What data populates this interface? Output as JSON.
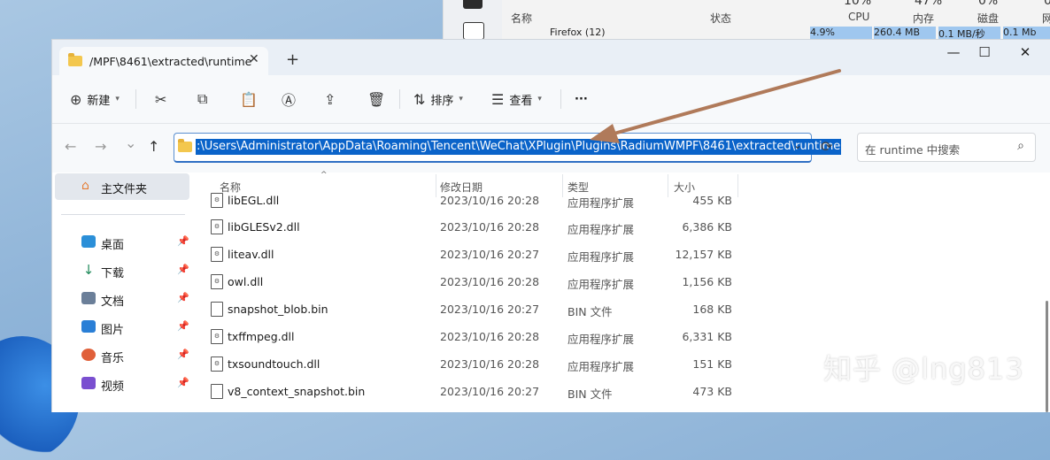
{
  "colors": {
    "accent": "#0a63c9",
    "arrow": "#b07a5a",
    "folder": "#f3c74e"
  },
  "taskmgr": {
    "col_name": "名称",
    "col_status": "状态",
    "cpu_pct": "10%",
    "cpu_label": "CPU",
    "mem_pct": "47%",
    "mem_label": "内存",
    "disk_pct": "0%",
    "disk_label": "磁盘",
    "net_pct": "0",
    "net_label": "网",
    "row_name": "Firefox (12)",
    "row_cpu": "4.9%",
    "row_mem": "260.4 MB",
    "row_disk": "0.1 MB/秒",
    "row_net": "0.1 Mb"
  },
  "explorer": {
    "tab_title": "/MPF\\8461\\extracted\\runtime",
    "tab_close": "✕",
    "new_tab": "+",
    "window_controls": {
      "minimize": "—",
      "maximize": "☐",
      "close": "✕"
    },
    "toolbar": {
      "new_label": "新建",
      "sort_label": "排序",
      "view_label": "查看",
      "more": "···"
    },
    "nav": {
      "back": "←",
      "forward": "→",
      "recent": "⌄",
      "up": "↑"
    },
    "address_path": ":\\Users\\Administrator\\AppData\\Roaming\\Tencent\\WeChat\\XPlugin\\Plugins\\RadiumWMPF\\8461\\extracted\\runtime",
    "search_placeholder": "在 runtime 中搜索",
    "sidebar": {
      "home": "主文件夹",
      "items": [
        {
          "label": "桌面",
          "icon": "desktop-icon",
          "color": "#2b8fd8"
        },
        {
          "label": "下载",
          "icon": "download-icon",
          "color": "#1f8a5a"
        },
        {
          "label": "文档",
          "icon": "documents-icon",
          "color": "#6b7f99"
        },
        {
          "label": "图片",
          "icon": "pictures-icon",
          "color": "#2a7fd6"
        },
        {
          "label": "音乐",
          "icon": "music-icon",
          "color": "#e0603a"
        },
        {
          "label": "视频",
          "icon": "videos-icon",
          "color": "#7a4fd0"
        }
      ]
    },
    "columns": {
      "name": "名称",
      "date": "修改日期",
      "type": "类型",
      "size": "大小"
    },
    "files": [
      {
        "name": "libEGL.dll",
        "date": "2023/10/16 20:28",
        "type": "应用程序扩展",
        "size": "455 KB",
        "kind": "dll"
      },
      {
        "name": "libGLESv2.dll",
        "date": "2023/10/16 20:28",
        "type": "应用程序扩展",
        "size": "6,386 KB",
        "kind": "dll"
      },
      {
        "name": "liteav.dll",
        "date": "2023/10/16 20:27",
        "type": "应用程序扩展",
        "size": "12,157 KB",
        "kind": "dll"
      },
      {
        "name": "owl.dll",
        "date": "2023/10/16 20:28",
        "type": "应用程序扩展",
        "size": "1,156 KB",
        "kind": "dll"
      },
      {
        "name": "snapshot_blob.bin",
        "date": "2023/10/16 20:27",
        "type": "BIN 文件",
        "size": "168 KB",
        "kind": "bin"
      },
      {
        "name": "txffmpeg.dll",
        "date": "2023/10/16 20:28",
        "type": "应用程序扩展",
        "size": "6,331 KB",
        "kind": "dll"
      },
      {
        "name": "txsoundtouch.dll",
        "date": "2023/10/16 20:28",
        "type": "应用程序扩展",
        "size": "151 KB",
        "kind": "dll"
      },
      {
        "name": "v8_context_snapshot.bin",
        "date": "2023/10/16 20:27",
        "type": "BIN 文件",
        "size": "473 KB",
        "kind": "bin"
      }
    ]
  },
  "watermark": "知乎 @lng813"
}
